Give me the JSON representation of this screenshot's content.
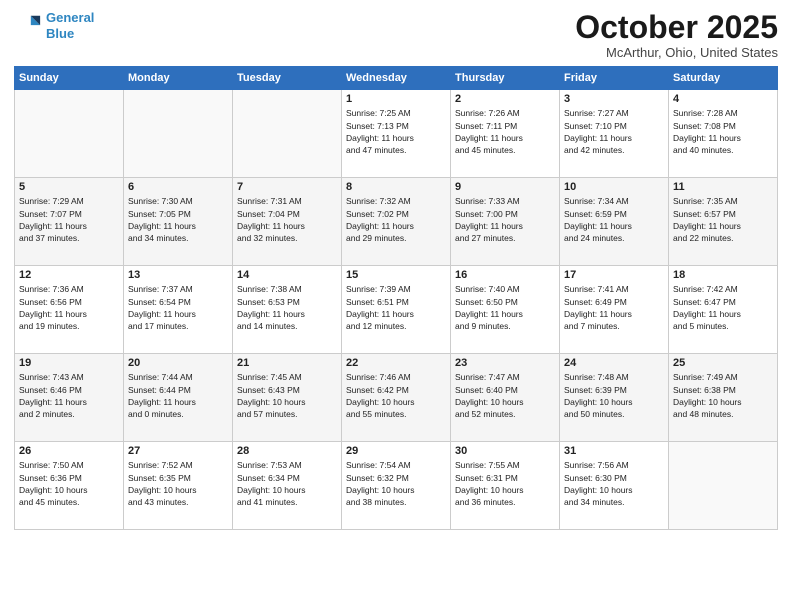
{
  "header": {
    "logo_line1": "General",
    "logo_line2": "Blue",
    "month": "October 2025",
    "location": "McArthur, Ohio, United States"
  },
  "days_of_week": [
    "Sunday",
    "Monday",
    "Tuesday",
    "Wednesday",
    "Thursday",
    "Friday",
    "Saturday"
  ],
  "weeks": [
    [
      {
        "day": "",
        "content": ""
      },
      {
        "day": "",
        "content": ""
      },
      {
        "day": "",
        "content": ""
      },
      {
        "day": "1",
        "content": "Sunrise: 7:25 AM\nSunset: 7:13 PM\nDaylight: 11 hours\nand 47 minutes."
      },
      {
        "day": "2",
        "content": "Sunrise: 7:26 AM\nSunset: 7:11 PM\nDaylight: 11 hours\nand 45 minutes."
      },
      {
        "day": "3",
        "content": "Sunrise: 7:27 AM\nSunset: 7:10 PM\nDaylight: 11 hours\nand 42 minutes."
      },
      {
        "day": "4",
        "content": "Sunrise: 7:28 AM\nSunset: 7:08 PM\nDaylight: 11 hours\nand 40 minutes."
      }
    ],
    [
      {
        "day": "5",
        "content": "Sunrise: 7:29 AM\nSunset: 7:07 PM\nDaylight: 11 hours\nand 37 minutes."
      },
      {
        "day": "6",
        "content": "Sunrise: 7:30 AM\nSunset: 7:05 PM\nDaylight: 11 hours\nand 34 minutes."
      },
      {
        "day": "7",
        "content": "Sunrise: 7:31 AM\nSunset: 7:04 PM\nDaylight: 11 hours\nand 32 minutes."
      },
      {
        "day": "8",
        "content": "Sunrise: 7:32 AM\nSunset: 7:02 PM\nDaylight: 11 hours\nand 29 minutes."
      },
      {
        "day": "9",
        "content": "Sunrise: 7:33 AM\nSunset: 7:00 PM\nDaylight: 11 hours\nand 27 minutes."
      },
      {
        "day": "10",
        "content": "Sunrise: 7:34 AM\nSunset: 6:59 PM\nDaylight: 11 hours\nand 24 minutes."
      },
      {
        "day": "11",
        "content": "Sunrise: 7:35 AM\nSunset: 6:57 PM\nDaylight: 11 hours\nand 22 minutes."
      }
    ],
    [
      {
        "day": "12",
        "content": "Sunrise: 7:36 AM\nSunset: 6:56 PM\nDaylight: 11 hours\nand 19 minutes."
      },
      {
        "day": "13",
        "content": "Sunrise: 7:37 AM\nSunset: 6:54 PM\nDaylight: 11 hours\nand 17 minutes."
      },
      {
        "day": "14",
        "content": "Sunrise: 7:38 AM\nSunset: 6:53 PM\nDaylight: 11 hours\nand 14 minutes."
      },
      {
        "day": "15",
        "content": "Sunrise: 7:39 AM\nSunset: 6:51 PM\nDaylight: 11 hours\nand 12 minutes."
      },
      {
        "day": "16",
        "content": "Sunrise: 7:40 AM\nSunset: 6:50 PM\nDaylight: 11 hours\nand 9 minutes."
      },
      {
        "day": "17",
        "content": "Sunrise: 7:41 AM\nSunset: 6:49 PM\nDaylight: 11 hours\nand 7 minutes."
      },
      {
        "day": "18",
        "content": "Sunrise: 7:42 AM\nSunset: 6:47 PM\nDaylight: 11 hours\nand 5 minutes."
      }
    ],
    [
      {
        "day": "19",
        "content": "Sunrise: 7:43 AM\nSunset: 6:46 PM\nDaylight: 11 hours\nand 2 minutes."
      },
      {
        "day": "20",
        "content": "Sunrise: 7:44 AM\nSunset: 6:44 PM\nDaylight: 11 hours\nand 0 minutes."
      },
      {
        "day": "21",
        "content": "Sunrise: 7:45 AM\nSunset: 6:43 PM\nDaylight: 10 hours\nand 57 minutes."
      },
      {
        "day": "22",
        "content": "Sunrise: 7:46 AM\nSunset: 6:42 PM\nDaylight: 10 hours\nand 55 minutes."
      },
      {
        "day": "23",
        "content": "Sunrise: 7:47 AM\nSunset: 6:40 PM\nDaylight: 10 hours\nand 52 minutes."
      },
      {
        "day": "24",
        "content": "Sunrise: 7:48 AM\nSunset: 6:39 PM\nDaylight: 10 hours\nand 50 minutes."
      },
      {
        "day": "25",
        "content": "Sunrise: 7:49 AM\nSunset: 6:38 PM\nDaylight: 10 hours\nand 48 minutes."
      }
    ],
    [
      {
        "day": "26",
        "content": "Sunrise: 7:50 AM\nSunset: 6:36 PM\nDaylight: 10 hours\nand 45 minutes."
      },
      {
        "day": "27",
        "content": "Sunrise: 7:52 AM\nSunset: 6:35 PM\nDaylight: 10 hours\nand 43 minutes."
      },
      {
        "day": "28",
        "content": "Sunrise: 7:53 AM\nSunset: 6:34 PM\nDaylight: 10 hours\nand 41 minutes."
      },
      {
        "day": "29",
        "content": "Sunrise: 7:54 AM\nSunset: 6:32 PM\nDaylight: 10 hours\nand 38 minutes."
      },
      {
        "day": "30",
        "content": "Sunrise: 7:55 AM\nSunset: 6:31 PM\nDaylight: 10 hours\nand 36 minutes."
      },
      {
        "day": "31",
        "content": "Sunrise: 7:56 AM\nSunset: 6:30 PM\nDaylight: 10 hours\nand 34 minutes."
      },
      {
        "day": "",
        "content": ""
      }
    ]
  ]
}
